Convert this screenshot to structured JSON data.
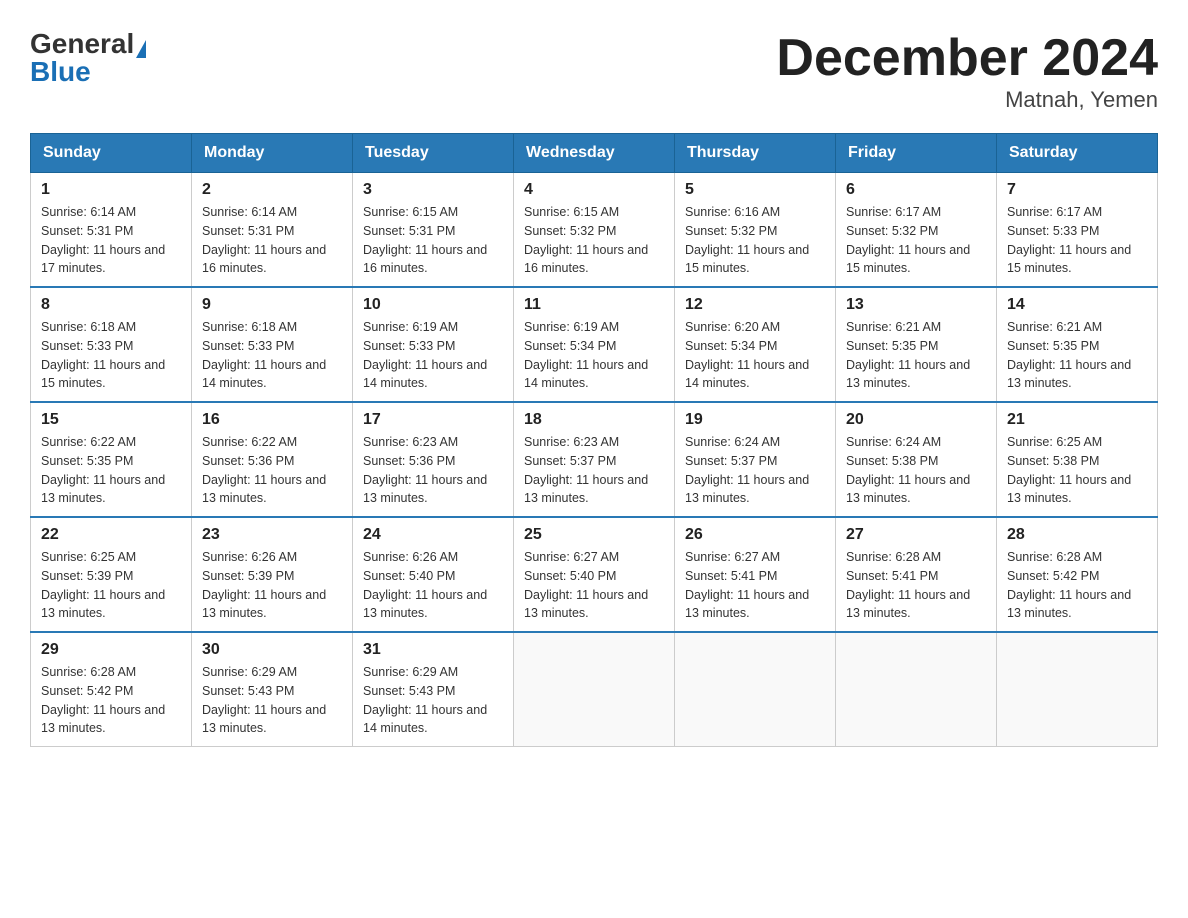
{
  "logo": {
    "general": "General",
    "blue": "Blue"
  },
  "title": "December 2024",
  "subtitle": "Matnah, Yemen",
  "days_of_week": [
    "Sunday",
    "Monday",
    "Tuesday",
    "Wednesday",
    "Thursday",
    "Friday",
    "Saturday"
  ],
  "weeks": [
    [
      {
        "day": "1",
        "sunrise": "6:14 AM",
        "sunset": "5:31 PM",
        "daylight": "11 hours and 17 minutes."
      },
      {
        "day": "2",
        "sunrise": "6:14 AM",
        "sunset": "5:31 PM",
        "daylight": "11 hours and 16 minutes."
      },
      {
        "day": "3",
        "sunrise": "6:15 AM",
        "sunset": "5:31 PM",
        "daylight": "11 hours and 16 minutes."
      },
      {
        "day": "4",
        "sunrise": "6:15 AM",
        "sunset": "5:32 PM",
        "daylight": "11 hours and 16 minutes."
      },
      {
        "day": "5",
        "sunrise": "6:16 AM",
        "sunset": "5:32 PM",
        "daylight": "11 hours and 15 minutes."
      },
      {
        "day": "6",
        "sunrise": "6:17 AM",
        "sunset": "5:32 PM",
        "daylight": "11 hours and 15 minutes."
      },
      {
        "day": "7",
        "sunrise": "6:17 AM",
        "sunset": "5:33 PM",
        "daylight": "11 hours and 15 minutes."
      }
    ],
    [
      {
        "day": "8",
        "sunrise": "6:18 AM",
        "sunset": "5:33 PM",
        "daylight": "11 hours and 15 minutes."
      },
      {
        "day": "9",
        "sunrise": "6:18 AM",
        "sunset": "5:33 PM",
        "daylight": "11 hours and 14 minutes."
      },
      {
        "day": "10",
        "sunrise": "6:19 AM",
        "sunset": "5:33 PM",
        "daylight": "11 hours and 14 minutes."
      },
      {
        "day": "11",
        "sunrise": "6:19 AM",
        "sunset": "5:34 PM",
        "daylight": "11 hours and 14 minutes."
      },
      {
        "day": "12",
        "sunrise": "6:20 AM",
        "sunset": "5:34 PM",
        "daylight": "11 hours and 14 minutes."
      },
      {
        "day": "13",
        "sunrise": "6:21 AM",
        "sunset": "5:35 PM",
        "daylight": "11 hours and 13 minutes."
      },
      {
        "day": "14",
        "sunrise": "6:21 AM",
        "sunset": "5:35 PM",
        "daylight": "11 hours and 13 minutes."
      }
    ],
    [
      {
        "day": "15",
        "sunrise": "6:22 AM",
        "sunset": "5:35 PM",
        "daylight": "11 hours and 13 minutes."
      },
      {
        "day": "16",
        "sunrise": "6:22 AM",
        "sunset": "5:36 PM",
        "daylight": "11 hours and 13 minutes."
      },
      {
        "day": "17",
        "sunrise": "6:23 AM",
        "sunset": "5:36 PM",
        "daylight": "11 hours and 13 minutes."
      },
      {
        "day": "18",
        "sunrise": "6:23 AM",
        "sunset": "5:37 PM",
        "daylight": "11 hours and 13 minutes."
      },
      {
        "day": "19",
        "sunrise": "6:24 AM",
        "sunset": "5:37 PM",
        "daylight": "11 hours and 13 minutes."
      },
      {
        "day": "20",
        "sunrise": "6:24 AM",
        "sunset": "5:38 PM",
        "daylight": "11 hours and 13 minutes."
      },
      {
        "day": "21",
        "sunrise": "6:25 AM",
        "sunset": "5:38 PM",
        "daylight": "11 hours and 13 minutes."
      }
    ],
    [
      {
        "day": "22",
        "sunrise": "6:25 AM",
        "sunset": "5:39 PM",
        "daylight": "11 hours and 13 minutes."
      },
      {
        "day": "23",
        "sunrise": "6:26 AM",
        "sunset": "5:39 PM",
        "daylight": "11 hours and 13 minutes."
      },
      {
        "day": "24",
        "sunrise": "6:26 AM",
        "sunset": "5:40 PM",
        "daylight": "11 hours and 13 minutes."
      },
      {
        "day": "25",
        "sunrise": "6:27 AM",
        "sunset": "5:40 PM",
        "daylight": "11 hours and 13 minutes."
      },
      {
        "day": "26",
        "sunrise": "6:27 AM",
        "sunset": "5:41 PM",
        "daylight": "11 hours and 13 minutes."
      },
      {
        "day": "27",
        "sunrise": "6:28 AM",
        "sunset": "5:41 PM",
        "daylight": "11 hours and 13 minutes."
      },
      {
        "day": "28",
        "sunrise": "6:28 AM",
        "sunset": "5:42 PM",
        "daylight": "11 hours and 13 minutes."
      }
    ],
    [
      {
        "day": "29",
        "sunrise": "6:28 AM",
        "sunset": "5:42 PM",
        "daylight": "11 hours and 13 minutes."
      },
      {
        "day": "30",
        "sunrise": "6:29 AM",
        "sunset": "5:43 PM",
        "daylight": "11 hours and 13 minutes."
      },
      {
        "day": "31",
        "sunrise": "6:29 AM",
        "sunset": "5:43 PM",
        "daylight": "11 hours and 14 minutes."
      },
      null,
      null,
      null,
      null
    ]
  ]
}
